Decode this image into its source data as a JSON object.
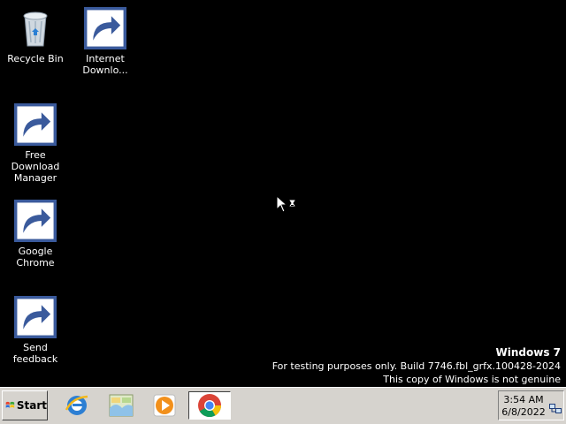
{
  "desktop": {
    "icons": [
      {
        "label": "Recycle Bin",
        "icon": "recycle-bin-icon"
      },
      {
        "label": "Internet Downlo...",
        "icon": "internet-download-manager-icon"
      },
      {
        "label": "Free Download Manager",
        "icon": "free-download-manager-icon"
      },
      {
        "label": "Google Chrome",
        "icon": "chrome-icon"
      },
      {
        "label": "Send feedback",
        "icon": "feedback-icon"
      }
    ],
    "background_color": "#000000"
  },
  "watermark": {
    "title": "Windows 7",
    "line1": "For testing purposes only. Build 7746.fbl_grfx.100428-2024",
    "line2": "This copy of Windows is not genuine"
  },
  "taskbar": {
    "start_label": "Start",
    "items": [
      {
        "icon": "internet-explorer-icon"
      },
      {
        "icon": "explorer-icon"
      },
      {
        "icon": "media-player-icon"
      },
      {
        "icon": "chrome-icon",
        "active": true
      }
    ],
    "clock": {
      "time": "3:54 AM",
      "date": "6/8/2022"
    },
    "tray_icon": "network-icon"
  }
}
